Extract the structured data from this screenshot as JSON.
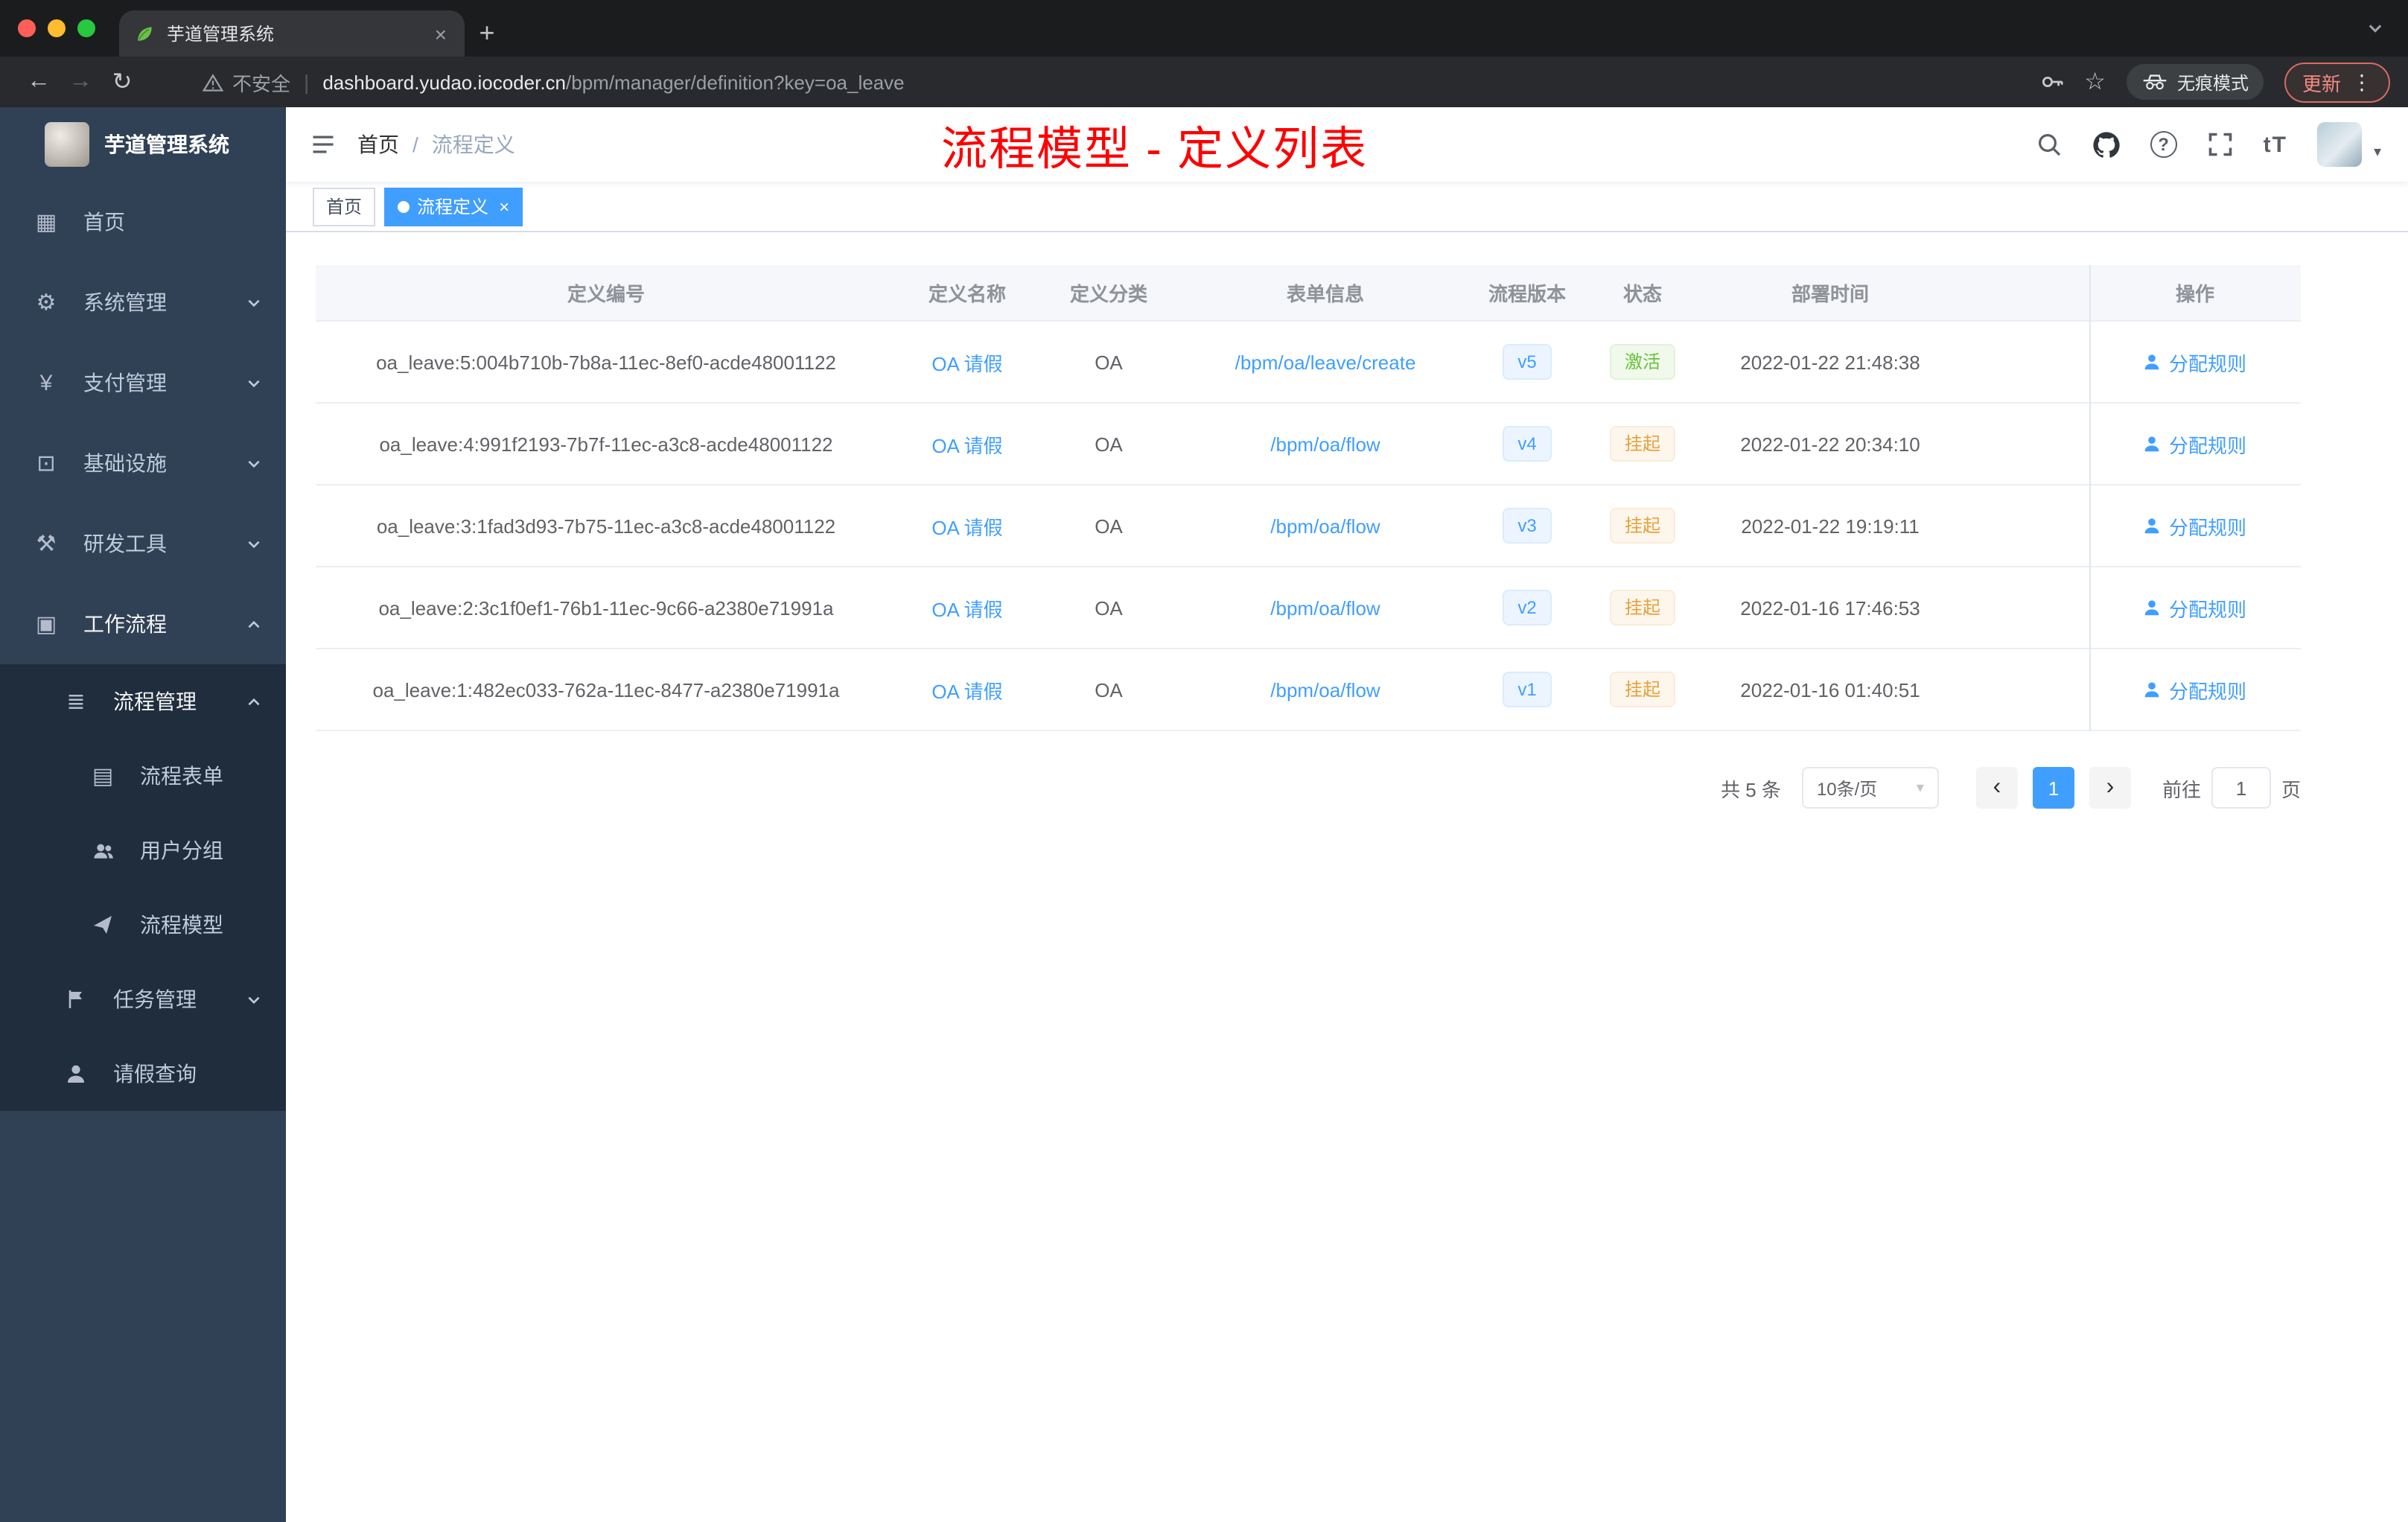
{
  "browser": {
    "tab": {
      "title": "芋道管理系统"
    },
    "address": {
      "security": "不安全",
      "domain": "dashboard.yudao.iocoder.cn",
      "path": "/bpm/manager/definition?key=oa_leave"
    },
    "incognito": "无痕模式",
    "update": "更新"
  },
  "icons": {
    "close": "×",
    "plus": "+",
    "back": "←",
    "forward": "→",
    "reload": "↻",
    "star": "☆",
    "more": "⋮",
    "divider": "|",
    "dashboard": "▦",
    "gear": "⚙",
    "yen": "¥",
    "infra": "⊡",
    "tools": "⚒",
    "workflow": "▣",
    "list": "≣",
    "form": "▤",
    "caret_down": "▾",
    "question": "?",
    "font_size": "tT",
    "prev": "‹",
    "next": "›"
  },
  "colors": {
    "accent": "#409eff",
    "success": "#67c23a",
    "warning": "#e6a23c",
    "annotation": "#fe0000",
    "sidebar": "#304156"
  },
  "sidebar": {
    "title": "芋道管理系统",
    "items": [
      {
        "label": "首页"
      },
      {
        "label": "系统管理"
      },
      {
        "label": "支付管理"
      },
      {
        "label": "基础设施"
      },
      {
        "label": "研发工具"
      },
      {
        "label": "工作流程"
      },
      {
        "label": "流程管理"
      },
      {
        "label": "流程表单"
      },
      {
        "label": "用户分组"
      },
      {
        "label": "流程模型"
      },
      {
        "label": "任务管理"
      },
      {
        "label": "请假查询"
      }
    ]
  },
  "header": {
    "breadcrumb_home": "首页",
    "breadcrumb_sep": "/",
    "breadcrumb_current": "流程定义",
    "annotation": "流程模型 - 定义列表"
  },
  "tags": {
    "home": "首页",
    "active": "流程定义"
  },
  "table": {
    "columns": [
      "定义编号",
      "定义名称",
      "定义分类",
      "表单信息",
      "流程版本",
      "状态",
      "部署时间",
      "操作"
    ],
    "rows": [
      {
        "id": "oa_leave:5:004b710b-7b8a-11ec-8ef0-acde48001122",
        "name": "OA 请假",
        "category": "OA",
        "form": "/bpm/oa/leave/create",
        "version": "v5",
        "status": "激活",
        "status_type": "success",
        "time": "2022-01-22 21:48:38",
        "action": "分配规则"
      },
      {
        "id": "oa_leave:4:991f2193-7b7f-11ec-a3c8-acde48001122",
        "name": "OA 请假",
        "category": "OA",
        "form": "/bpm/oa/flow",
        "version": "v4",
        "status": "挂起",
        "status_type": "warning",
        "time": "2022-01-22 20:34:10",
        "action": "分配规则"
      },
      {
        "id": "oa_leave:3:1fad3d93-7b75-11ec-a3c8-acde48001122",
        "name": "OA 请假",
        "category": "OA",
        "form": "/bpm/oa/flow",
        "version": "v3",
        "status": "挂起",
        "status_type": "warning",
        "time": "2022-01-22 19:19:11",
        "action": "分配规则"
      },
      {
        "id": "oa_leave:2:3c1f0ef1-76b1-11ec-9c66-a2380e71991a",
        "name": "OA 请假",
        "category": "OA",
        "form": "/bpm/oa/flow",
        "version": "v2",
        "status": "挂起",
        "status_type": "warning",
        "time": "2022-01-16 17:46:53",
        "action": "分配规则"
      },
      {
        "id": "oa_leave:1:482ec033-762a-11ec-8477-a2380e71991a",
        "name": "OA 请假",
        "category": "OA",
        "form": "/bpm/oa/flow",
        "version": "v1",
        "status": "挂起",
        "status_type": "warning",
        "time": "2022-01-16 01:40:51",
        "action": "分配规则"
      }
    ]
  },
  "pagination": {
    "total": "共 5 条",
    "size": "10条/页",
    "page": "1",
    "goto": "前往",
    "goto_value": "1",
    "unit": "页"
  }
}
